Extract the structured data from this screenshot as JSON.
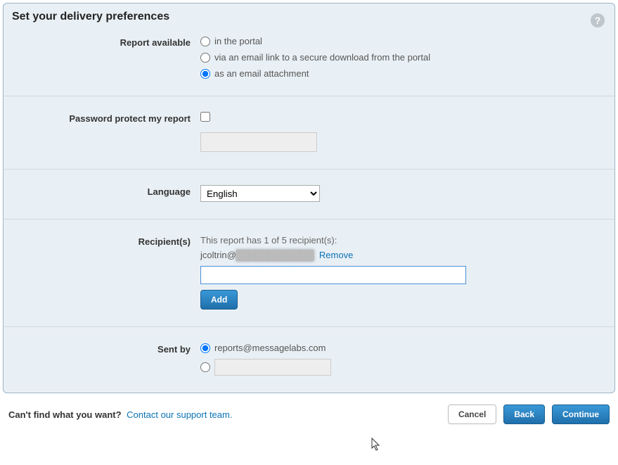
{
  "panel": {
    "title": "Set your delivery preferences",
    "help": "?"
  },
  "report_available": {
    "label": "Report available",
    "opt_portal": "in the portal",
    "opt_email_link": "via an email link to a secure download from the portal",
    "opt_attachment": "as an email attachment",
    "selected": "attachment"
  },
  "password": {
    "label": "Password protect my report",
    "value": ""
  },
  "language": {
    "label": "Language",
    "selected": "English"
  },
  "recipients": {
    "label": "Recipient(s)",
    "info": "This report has 1 of 5 recipient(s):",
    "email_prefix": "jcoltrin@",
    "email_blurred": "████████████",
    "remove": "Remove",
    "add": "Add"
  },
  "sent_by": {
    "label": "Sent by",
    "default_email": "reports@messagelabs.com",
    "custom_value": ""
  },
  "footer": {
    "prompt": "Can't find what you want?",
    "support": "Contact our support team.",
    "cancel": "Cancel",
    "back": "Back",
    "continue": "Continue"
  }
}
